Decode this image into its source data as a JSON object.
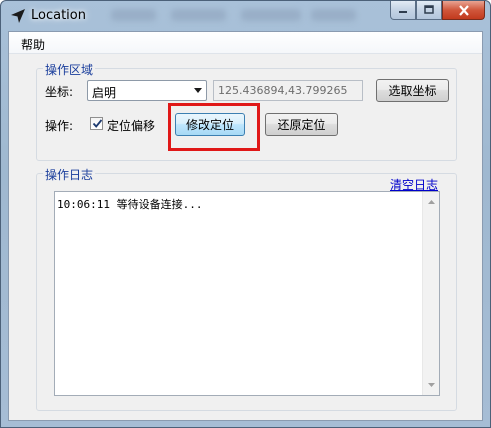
{
  "window": {
    "title": "Location"
  },
  "menu": {
    "items": [
      {
        "label": "帮助"
      }
    ]
  },
  "operation_area": {
    "title": "操作区域",
    "coord_label": "坐标:",
    "coord_source": {
      "selected": "启明"
    },
    "coord_value": "125.436894,43.799265",
    "pick_button": "选取坐标",
    "ops_label": "操作:",
    "offset_checkbox": {
      "label": "定位偏移",
      "checked": true
    },
    "modify_button": "修改定位",
    "restore_button": "还原定位"
  },
  "log": {
    "title": "操作日志",
    "clear_link": "清空日志",
    "lines": [
      "10:06:11 等待设备连接..."
    ]
  },
  "colors": {
    "group_title": "#1a3e9c",
    "link": "#0000cc",
    "highlight_box": "#e01818"
  },
  "icons": {
    "app": "navigation-arrow-icon",
    "minimize": "minimize-icon",
    "maximize": "maximize-icon",
    "close": "close-icon",
    "dropdown": "chevron-down-icon",
    "scroll_up": "scroll-up-icon",
    "scroll_down": "scroll-down-icon"
  }
}
